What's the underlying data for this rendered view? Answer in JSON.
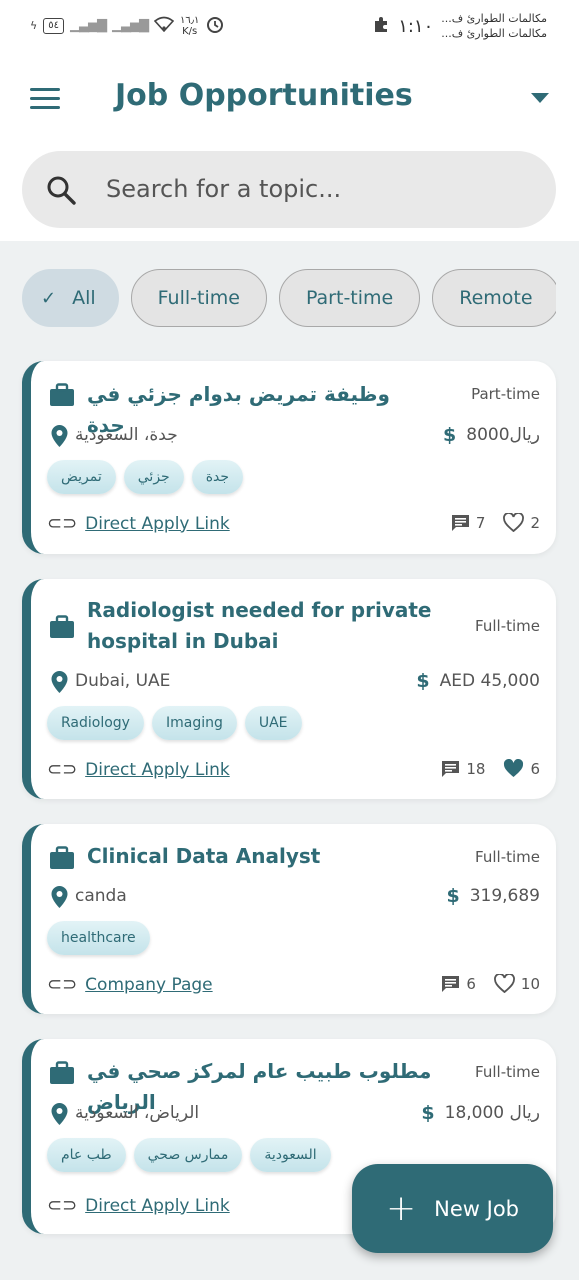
{
  "status_bar": {
    "battery": "٥٤",
    "speed_value": "١٦٫١",
    "speed_unit": "K/s",
    "time": "١:١٠",
    "notification_1": "مكالمات الطوارئ ف...",
    "notification_2": "مكالمات الطوارئ ف..."
  },
  "header": {
    "title": "Job Opportunities"
  },
  "search": {
    "placeholder": "Search for a topic..."
  },
  "filters": {
    "chips": [
      "All",
      "Full-time",
      "Part-time",
      "Remote"
    ],
    "selected": "All"
  },
  "jobs": [
    {
      "title": "وظيفة تمريض بدوام جزئي في جدة",
      "type": "Part-time",
      "location": "جدة، السعودية",
      "salary": "ريال8000",
      "tags": [
        "جدة",
        "جزئي",
        "تمريض"
      ],
      "link": "Direct Apply Link",
      "comments": "7",
      "likes": "2",
      "liked": false
    },
    {
      "title_line1": "Radiologist needed for private",
      "title_line2": "hospital in Dubai",
      "type": "Full-time",
      "location": "Dubai, UAE",
      "salary": "AED 45,000",
      "tags": [
        "Radiology",
        "Imaging",
        "UAE"
      ],
      "link": "Direct Apply Link",
      "comments": "18",
      "likes": "6",
      "liked": true
    },
    {
      "title": "Clinical Data Analyst",
      "type": "Full-time",
      "location": "canda",
      "salary": "319,689",
      "tags": [
        "healthcare"
      ],
      "link": "Company Page",
      "comments": "6",
      "likes": "10",
      "liked": false
    },
    {
      "title": "مطلوب طبيب عام لمركز صحي في الرياض",
      "type": "Full-time",
      "location": "الرياض، السعودية",
      "salary": "ريال 18,000",
      "tags": [
        "السعودية",
        "ممارس صحي",
        "طب عام"
      ],
      "link": "Direct Apply Link"
    }
  ],
  "fab": {
    "label": "New Job"
  },
  "colors": {
    "primary": "#2f6b76",
    "background": "#eef1f2",
    "chip_selected": "#cfdbe2"
  },
  "icons": [
    "menu-icon",
    "chevron-down-icon",
    "search-icon",
    "check-icon",
    "briefcase-icon",
    "location-pin-icon",
    "dollar-icon",
    "link-icon",
    "comment-icon",
    "heart-icon",
    "plus-icon"
  ]
}
